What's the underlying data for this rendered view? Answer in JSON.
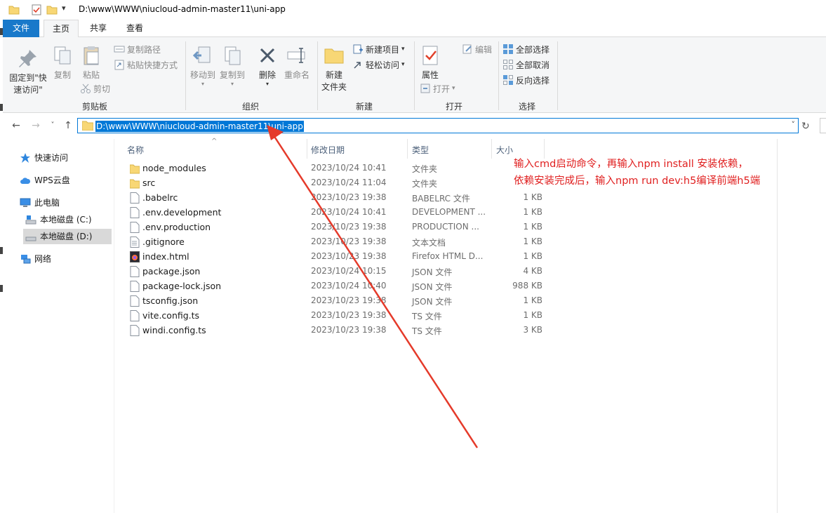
{
  "window": {
    "title": "D:\\www\\WWW\\niucloud-admin-master11\\uni-app"
  },
  "ribbon_tabs": [
    "文件",
    "主页",
    "共享",
    "查看"
  ],
  "ribbon": {
    "clipboard": {
      "pin_label_line1": "固定到\"快",
      "pin_label_line2": "速访问\"",
      "copy": "复制",
      "paste": "粘贴",
      "copy_path": "复制路径",
      "paste_shortcut": "粘贴快捷方式",
      "cut": "剪切",
      "group": "剪贴板"
    },
    "organize": {
      "move_to": "移动到",
      "copy_to": "复制到",
      "delete": "删除",
      "rename": "重命名",
      "group": "组织"
    },
    "new": {
      "new_folder_line1": "新建",
      "new_folder_line2": "文件夹",
      "new_item": "新建项目",
      "easy_access": "轻松访问",
      "group": "新建"
    },
    "open": {
      "properties": "属性",
      "open": "打开",
      "edit": "编辑",
      "group": "打开"
    },
    "select": {
      "select_all": "全部选择",
      "select_none": "全部取消",
      "invert": "反向选择",
      "group": "选择"
    }
  },
  "address": {
    "path": "D:\\www\\WWW\\niucloud-admin-master11\\uni-app"
  },
  "nav_pane": {
    "quick_access": "快速访问",
    "wps_cloud": "WPS云盘",
    "this_pc": "此电脑",
    "disk_c": "本地磁盘 (C:)",
    "disk_d": "本地磁盘 (D:)",
    "network": "网络"
  },
  "columns": {
    "name": "名称",
    "date": "修改日期",
    "type": "类型",
    "size": "大小"
  },
  "files": [
    {
      "name": "node_modules",
      "date": "2023/10/24 10:41",
      "type": "文件夹",
      "size": "",
      "kind": "folder"
    },
    {
      "name": "src",
      "date": "2023/10/24 11:04",
      "type": "文件夹",
      "size": "",
      "kind": "folder"
    },
    {
      "name": ".babelrc",
      "date": "2023/10/23 19:38",
      "type": "BABELRC 文件",
      "size": "1 KB",
      "kind": "file"
    },
    {
      "name": ".env.development",
      "date": "2023/10/24 10:41",
      "type": "DEVELOPMENT ...",
      "size": "1 KB",
      "kind": "file"
    },
    {
      "name": ".env.production",
      "date": "2023/10/23 19:38",
      "type": "PRODUCTION ...",
      "size": "1 KB",
      "kind": "file"
    },
    {
      "name": ".gitignore",
      "date": "2023/10/23 19:38",
      "type": "文本文档",
      "size": "1 KB",
      "kind": "text"
    },
    {
      "name": "index.html",
      "date": "2023/10/23 19:38",
      "type": "Firefox HTML D...",
      "size": "1 KB",
      "kind": "html"
    },
    {
      "name": "package.json",
      "date": "2023/10/24 10:15",
      "type": "JSON 文件",
      "size": "4 KB",
      "kind": "file"
    },
    {
      "name": "package-lock.json",
      "date": "2023/10/24 10:40",
      "type": "JSON 文件",
      "size": "988 KB",
      "kind": "file"
    },
    {
      "name": "tsconfig.json",
      "date": "2023/10/23 19:38",
      "type": "JSON 文件",
      "size": "1 KB",
      "kind": "file"
    },
    {
      "name": "vite.config.ts",
      "date": "2023/10/23 19:38",
      "type": "TS 文件",
      "size": "1 KB",
      "kind": "file"
    },
    {
      "name": "windi.config.ts",
      "date": "2023/10/23 19:38",
      "type": "TS 文件",
      "size": "3 KB",
      "kind": "file"
    }
  ],
  "annotation": {
    "line1": "输入cmd启动命令，再输入npm install 安装依赖，",
    "line2": "依赖安装完成后，输入npm run dev:h5编译前端h5端",
    "color": "#e02020"
  },
  "colors": {
    "accent": "#0078d7",
    "file_tab": "#1979ca",
    "folder": "#f8d775"
  }
}
